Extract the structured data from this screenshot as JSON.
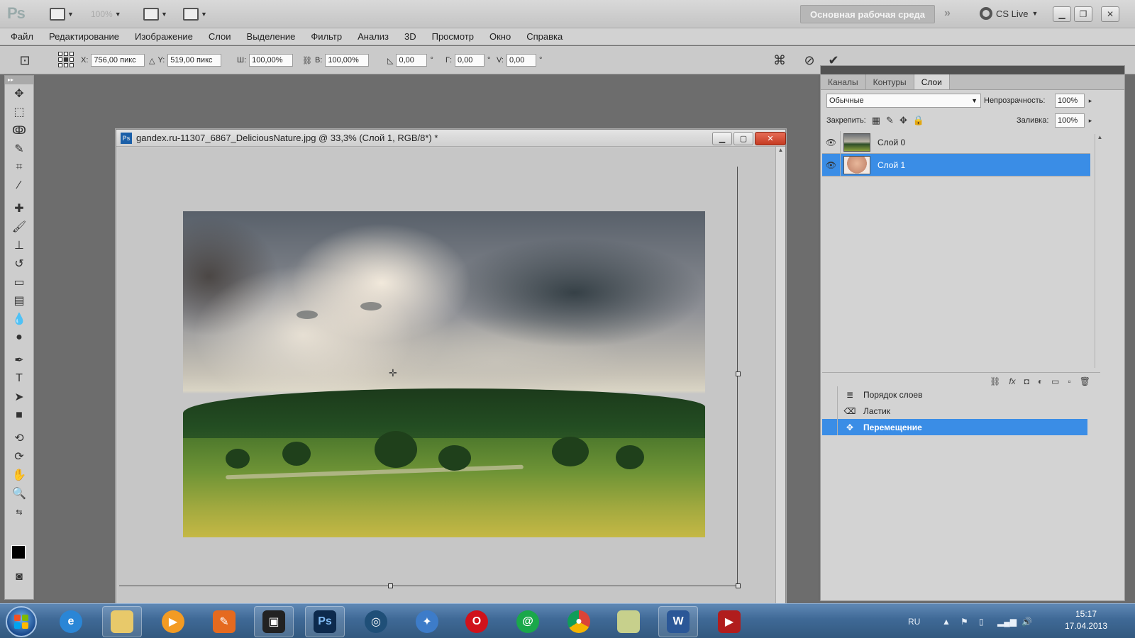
{
  "app": {
    "logo": "Ps",
    "zoom_level": "100%",
    "workspace_label": "Основная рабочая среда",
    "cs_live_label": "CS Live"
  },
  "menu": [
    "Файл",
    "Редактирование",
    "Изображение",
    "Слои",
    "Выделение",
    "Фильтр",
    "Анализ",
    "3D",
    "Просмотр",
    "Окно",
    "Справка"
  ],
  "options": {
    "x_label": "X:",
    "x_value": "756,00 пикс",
    "y_label": "Y:",
    "y_value": "519,00 пикс",
    "w_label": "Ш:",
    "w_value": "100,00%",
    "h_label": "В:",
    "h_value": "100,00%",
    "angle_value": "0,00",
    "angle_unit": "°",
    "hskew_label": "Г:",
    "hskew_value": "0,00",
    "vskew_label": "V:",
    "vskew_value": "0,00"
  },
  "document": {
    "title": "gandex.ru-11307_6867_DeliciousNature.jpg @ 33,3% (Слой 1, RGB/8*) *",
    "badge": "Ps"
  },
  "layers_panel": {
    "tabs": [
      "Каналы",
      "Контуры",
      "Слои"
    ],
    "active_tab": "Слои",
    "blend_mode": "Обычные",
    "opacity_label": "Непрозрачность:",
    "opacity_value": "100%",
    "lock_label": "Закрепить:",
    "fill_label": "Заливка:",
    "fill_value": "100%",
    "layers": [
      {
        "name": "Слой 0",
        "selected": false
      },
      {
        "name": "Слой 1",
        "selected": true
      }
    ],
    "footer_icons": [
      "link-icon",
      "fx-icon",
      "mask-icon",
      "adjustment-icon",
      "folder-icon",
      "new-layer-icon",
      "trash-icon"
    ]
  },
  "history_panel": {
    "items": [
      {
        "label": "Порядок слоев",
        "selected": false
      },
      {
        "label": "Ластик",
        "selected": false
      },
      {
        "label": "Перемещение",
        "selected": true
      }
    ]
  },
  "taskbar": {
    "apps": [
      "start",
      "internet-explorer",
      "explorer",
      "media-player",
      "paint",
      "media-center",
      "photoshop",
      "steam",
      "safari",
      "opera",
      "mail-agent",
      "chrome",
      "notepad",
      "word",
      "video-app"
    ],
    "lang": "RU",
    "time": "15:17",
    "date": "17.04.2013"
  },
  "colors": {
    "accent": "#3a8de6",
    "foreground_color": "#000000",
    "background_color": "#ffffff"
  }
}
